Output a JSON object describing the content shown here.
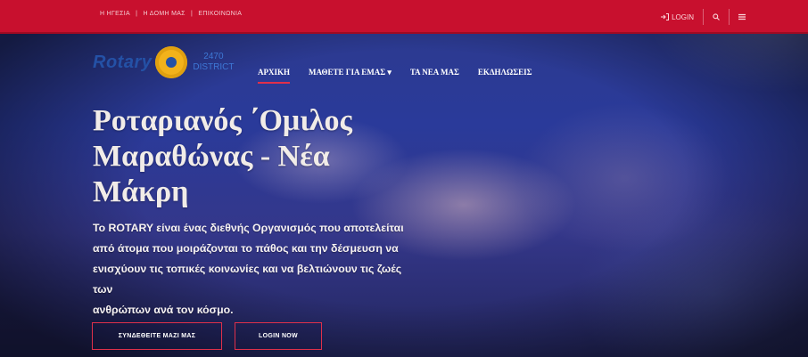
{
  "topbar": {
    "links": [
      "Η ΗΓΕΣΙΑ",
      "|",
      "Η ΔΟΜΗ ΜΑΣ",
      "|",
      "ΕΠΙΚΟΙΝΩΝΙΑ"
    ],
    "login_label": "LOGIN",
    "login_icon": "login-icon",
    "search_icon": "search-icon",
    "menu_icon": "menu-icon"
  },
  "brand": {
    "wordmark": "Rotary",
    "district_number": "2470",
    "district_label": "DISTRICT"
  },
  "nav": {
    "items": [
      {
        "label": "ΑΡΧΙΚΗ",
        "active": true
      },
      {
        "label": "ΜΑΘΕΤΕ ΓΙΑ ΕΜΑΣ ▾",
        "active": false
      },
      {
        "label": "ΤΑ ΝΕΑ ΜΑΣ",
        "active": false
      },
      {
        "label": "ΕΚΔΗΛΩΣΕΙΣ",
        "active": false
      }
    ]
  },
  "hero": {
    "title_lines": [
      "Ροταριανός ΄Ομιλος",
      "Μαραθώνας - Νέα",
      "Μάκρη"
    ],
    "body_lines": [
      "Το ROTARY είναι ένας διεθνής Οργανισμός που αποτελείται",
      "από άτομα που μοιράζονται το πάθος και την δέσμευση να",
      "ενισχύουν τις τοπικές κοινωνίες και να βελτιώνουν τις ζωές των",
      "ανθρώπων ανά τον κόσμο."
    ],
    "primary_button": "ΣΥΝΔΕΘΕΙΤΕ ΜΑΖΙ ΜΑΣ",
    "secondary_button": "LOGIN NOW"
  },
  "colors": {
    "topbar": "#c8102e",
    "accent": "#e0304a",
    "rotary_blue": "#2451a6",
    "rotary_gold": "#f2b21b"
  }
}
